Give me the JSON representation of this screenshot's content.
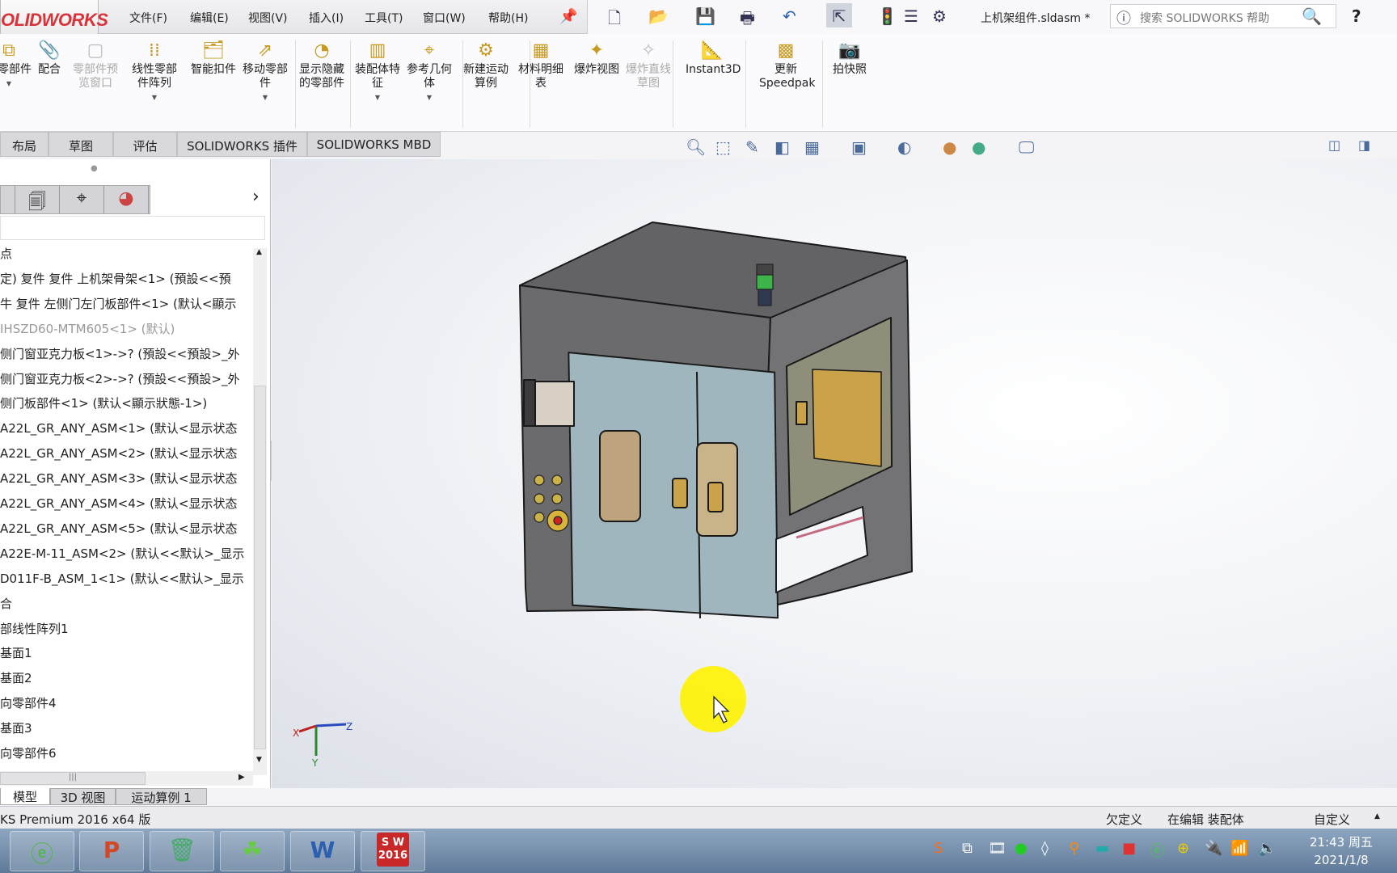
{
  "app": {
    "logo_text": "OLIDWORKS",
    "title": "上机架组件.sldasm *",
    "search_placeholder": "搜索 SOLIDWORKS 帮助",
    "help": "?"
  },
  "menu": [
    "文件(F)",
    "编辑(E)",
    "视图(V)",
    "插入(I)",
    "工具(T)",
    "窗口(W)",
    "帮助(H)"
  ],
  "ribbon": [
    {
      "label": "入零部件",
      "icon": "insert-component-icon",
      "disabled": false
    },
    {
      "label": "配合",
      "icon": "mate-icon",
      "disabled": false
    },
    {
      "label": "零部件预览窗口",
      "icon": "preview-window-icon",
      "disabled": true
    },
    {
      "label": "线性零部件阵列",
      "icon": "linear-pattern-icon",
      "disabled": false
    },
    {
      "label": "智能扣件",
      "icon": "smart-fastener-icon",
      "disabled": false
    },
    {
      "label": "移动零部件",
      "icon": "move-component-icon",
      "disabled": false
    },
    {
      "label": "显示隐藏的零部件",
      "icon": "show-hidden-icon",
      "disabled": false
    },
    {
      "label": "装配体特征",
      "icon": "assembly-feature-icon",
      "disabled": false
    },
    {
      "label": "参考几何体",
      "icon": "reference-geometry-icon",
      "disabled": false
    },
    {
      "label": "新建运动算例",
      "icon": "motion-study-icon",
      "disabled": false
    },
    {
      "label": "材料明细表",
      "icon": "bom-icon",
      "disabled": false
    },
    {
      "label": "爆炸视图",
      "icon": "exploded-view-icon",
      "disabled": false
    },
    {
      "label": "爆炸直线草图",
      "icon": "explode-line-icon",
      "disabled": true
    },
    {
      "label": "Instant3D",
      "icon": "instant3d-icon",
      "disabled": false
    },
    {
      "label": "更新Speedpak",
      "icon": "speedpak-icon",
      "disabled": false
    },
    {
      "label": "拍快照",
      "icon": "camera-icon",
      "disabled": false
    }
  ],
  "tabs": [
    "布局",
    "草图",
    "评估",
    "SOLIDWORKS 插件",
    "SOLIDWORKS MBD"
  ],
  "tree": [
    {
      "text": "点",
      "suppressed": false
    },
    {
      "text": "定) 复件 复件 上机架骨架<1> (預設<<預",
      "suppressed": false
    },
    {
      "text": "牛 复件 左侧门左门板部件<1> (默认<顯示",
      "suppressed": false
    },
    {
      "text": "IHSZD60-MTM605<1> (默认)",
      "suppressed": true
    },
    {
      "text": "侧门窗亚克力板<1>->? (預設<<預設>_外",
      "suppressed": false
    },
    {
      "text": "侧门窗亚克力板<2>->? (預設<<預設>_外",
      "suppressed": false
    },
    {
      "text": "侧门板部件<1> (默认<顯示狀態-1>)",
      "suppressed": false
    },
    {
      "text": "A22L_GR_ANY_ASM<1> (默认<显示状态",
      "suppressed": false
    },
    {
      "text": "A22L_GR_ANY_ASM<2> (默认<显示状态",
      "suppressed": false
    },
    {
      "text": "A22L_GR_ANY_ASM<3> (默认<显示状态",
      "suppressed": false
    },
    {
      "text": "A22L_GR_ANY_ASM<4> (默认<显示状态",
      "suppressed": false
    },
    {
      "text": "A22L_GR_ANY_ASM<5> (默认<显示状态",
      "suppressed": false
    },
    {
      "text": "A22E-M-11_ASM<2> (默认<<默认>_显示",
      "suppressed": false
    },
    {
      "text": "D011F-B_ASM_1<1> (默认<<默认>_显示",
      "suppressed": false
    },
    {
      "text": "合",
      "suppressed": false
    },
    {
      "text": "部线性阵列1",
      "suppressed": false
    },
    {
      "text": "基面1",
      "suppressed": false
    },
    {
      "text": "基面2",
      "suppressed": false
    },
    {
      "text": "向零部件4",
      "suppressed": false
    },
    {
      "text": "基面3",
      "suppressed": false
    },
    {
      "text": "向零部件6",
      "suppressed": false
    }
  ],
  "bottom_tabs": [
    "模型",
    "3D 视图",
    "运动算例 1"
  ],
  "status": {
    "left": "KS Premium 2016 x64 版",
    "under_defined": "欠定义",
    "editing": "在编辑 装配体",
    "custom": "自定义"
  },
  "triad": {
    "x": "X",
    "y": "Y",
    "z": "Z"
  },
  "taskbar": {
    "apps": [
      "ie-icon",
      "powerpoint-icon",
      "recycle-icon",
      "clover-icon",
      "word-icon",
      "solidworks-icon"
    ],
    "sw_label": "S W\n2016",
    "time": "21:43 周五",
    "date": "2021/1/8"
  },
  "colors": {
    "body": "#6b6b6e",
    "door": "#9fb6be",
    "amber": "#c9a24a",
    "cursor_highlight": "#ffee00",
    "logo": "#d8323a"
  }
}
